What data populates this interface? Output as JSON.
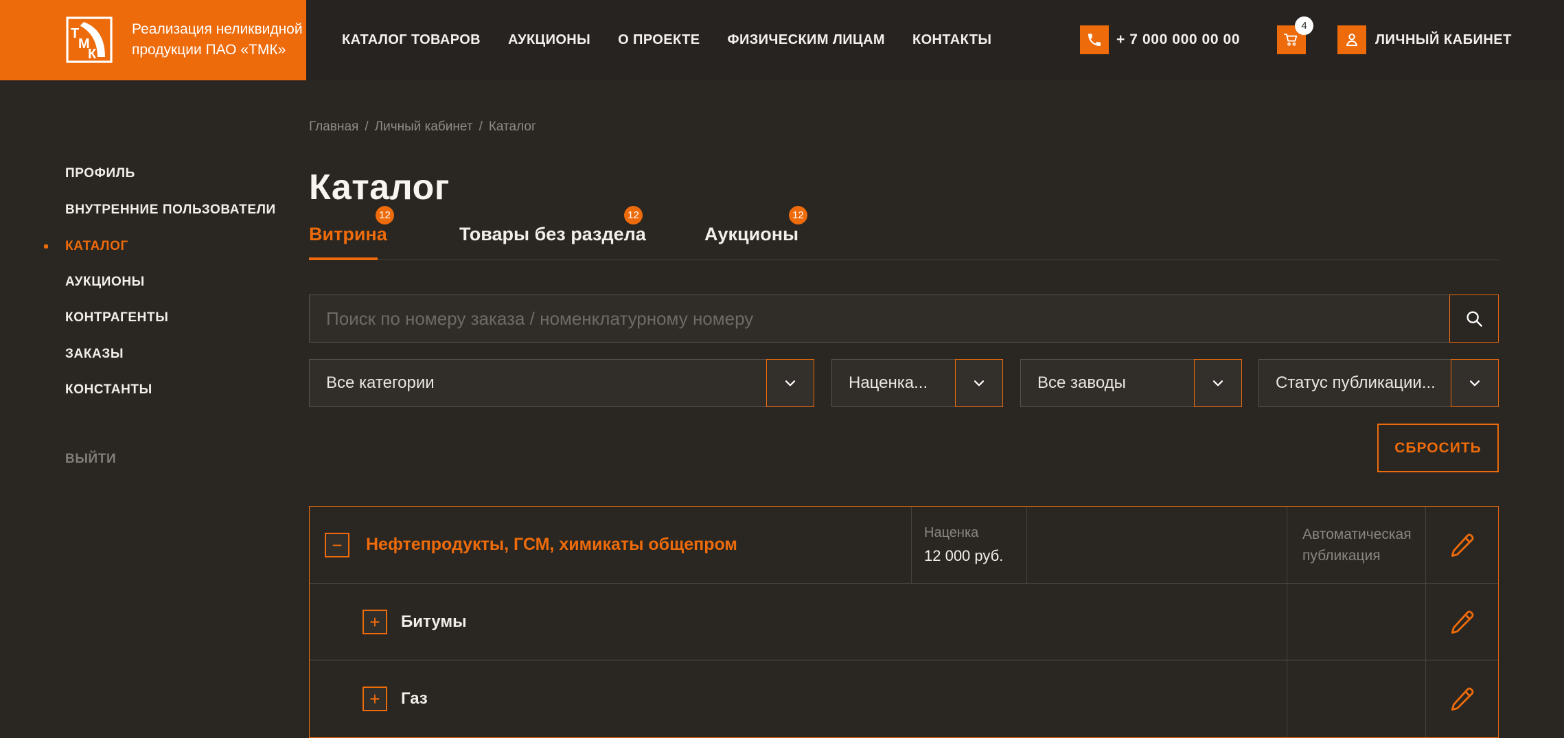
{
  "colors": {
    "accent": "#ed6b0b",
    "muted_text": "#8b867e"
  },
  "brand": {
    "logo_letters": {
      "l1": "Т",
      "l2": "М",
      "l3": "К"
    },
    "tagline_line1": "Реализация неликвидной",
    "tagline_line2": "продукции ПАО «ТМК»"
  },
  "header": {
    "nav": [
      {
        "label": "КАТАЛОГ ТОВАРОВ"
      },
      {
        "label": "АУКЦИОНЫ"
      },
      {
        "label": "О ПРОЕКТЕ"
      },
      {
        "label": "ФИЗИЧЕСКИМ ЛИЦАМ"
      },
      {
        "label": "КОНТАКТЫ"
      }
    ],
    "phone": "+ 7 000 000 00 00",
    "cart_count": "4",
    "account_label": "ЛИЧНЫЙ КАБИНЕТ"
  },
  "sidebar": {
    "items": [
      {
        "label": "ПРОФИЛЬ"
      },
      {
        "label": "ВНУТРЕННИЕ ПОЛЬЗОВАТЕЛИ"
      },
      {
        "label": "КАТАЛОГ"
      },
      {
        "label": "АУКЦИОНЫ"
      },
      {
        "label": "КОНТРАГЕНТЫ"
      },
      {
        "label": "ЗАКАЗЫ"
      },
      {
        "label": "КОНСТАНТЫ"
      }
    ],
    "logout_label": "ВЫЙТИ"
  },
  "breadcrumb": {
    "items": {
      "home": "Главная",
      "cabinet": "Личный кабинет",
      "current": "Каталог"
    },
    "separator": "/"
  },
  "page": {
    "title": "Каталог"
  },
  "tabs": [
    {
      "label": "Витрина",
      "badge": "12",
      "active": true
    },
    {
      "label": "Товары без раздела",
      "badge": "12",
      "active": false
    },
    {
      "label": "Аукционы",
      "badge": "12",
      "active": false
    }
  ],
  "search": {
    "placeholder": "Поиск по номеру заказа / номенклатурному номеру"
  },
  "filters": [
    {
      "value": "Все категории"
    },
    {
      "value": "Наценка..."
    },
    {
      "value": "Все заводы"
    },
    {
      "value": "Статус публикации..."
    }
  ],
  "actions": {
    "reset_label": "СБРОСИТЬ"
  },
  "catalog_table": {
    "rows": [
      {
        "toggle_symbol": "−",
        "name": "Нефтепродукты, ГСМ, химикаты общепром",
        "markup_label": "Наценка",
        "markup_value": "12 000 руб.",
        "publication": "Автоматическая публикация"
      },
      {
        "toggle_symbol": "+",
        "name": "Битумы"
      },
      {
        "toggle_symbol": "+",
        "name": "Газ"
      }
    ]
  }
}
